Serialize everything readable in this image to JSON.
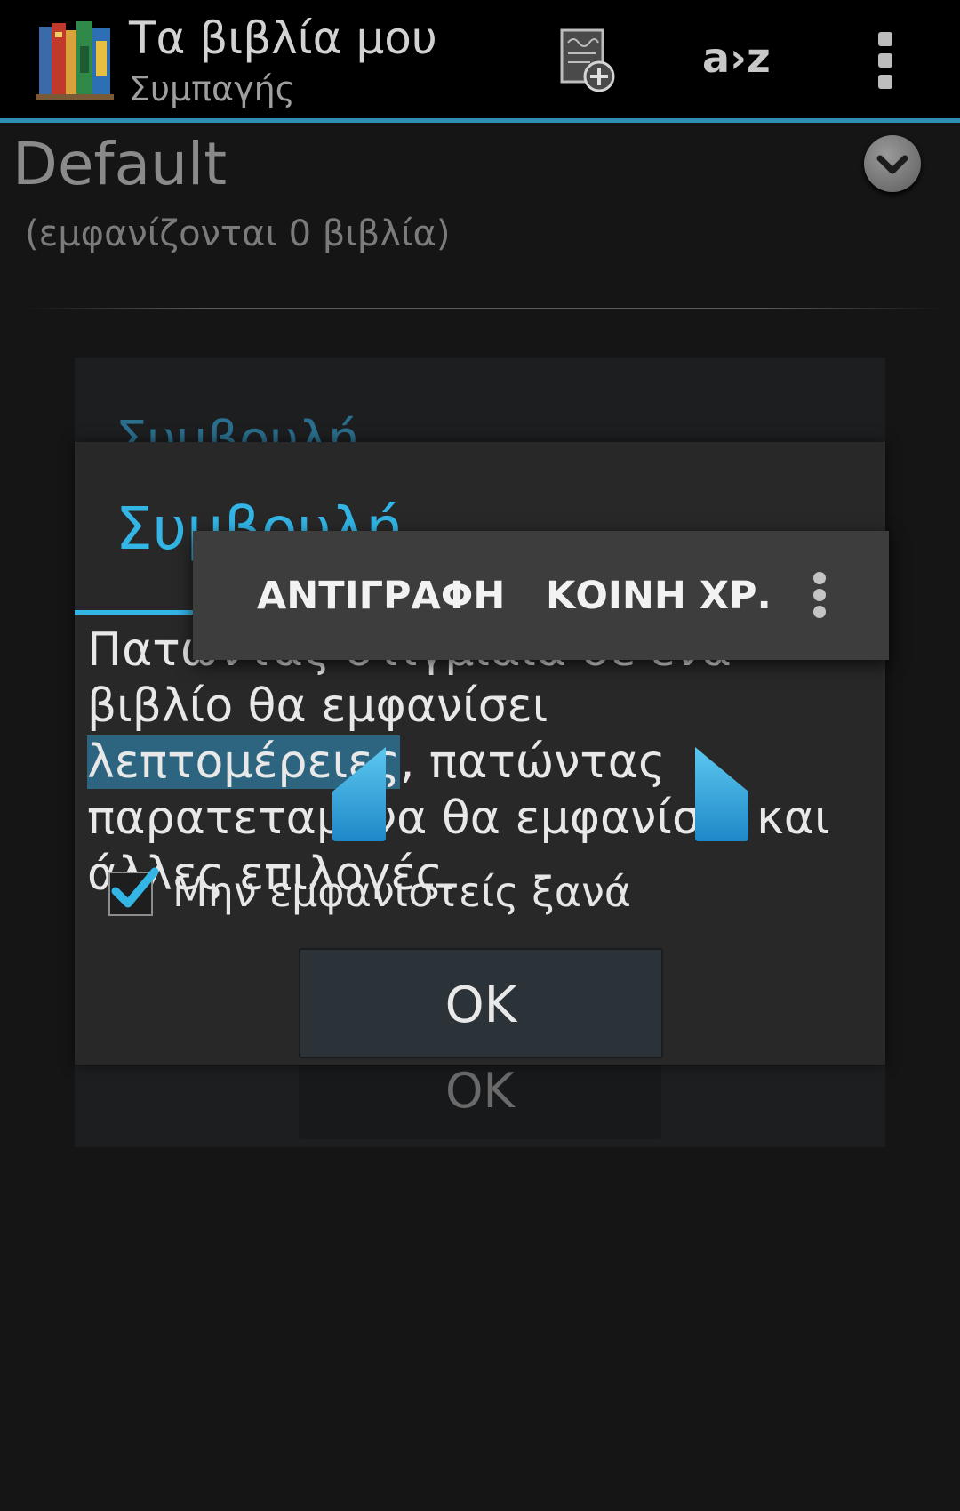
{
  "actionbar": {
    "title": "Τα βιβλία μου",
    "subtitle": "Συμπαγής",
    "sort_label": "a›z"
  },
  "shelf": {
    "name": "Default",
    "count_text": "(εμφανίζονται 0 βιβλία)"
  },
  "dialog": {
    "title": "Συμβουλή",
    "message_before": "Πατώντας στιγμιαία σε ένα βιβλίο θα εμφανίσει ",
    "message_selected": "λεπτομέρειες",
    "message_after": ", πατώντας παρατεταμένα θα εμφανίσει και άλλες επιλογές.",
    "checkbox_label": "Μην εμφανιστείς ξανά",
    "checkbox_checked": true,
    "ok_label": "OK"
  },
  "context_menu": {
    "copy_label": "ΑΝΤΙΓΡΑΦΗ",
    "share_label": "ΚΟΙΝΗ ΧΡ."
  },
  "colors": {
    "accent": "#33b5e5",
    "selection": "#2d6581",
    "background": "#151515"
  },
  "icons": {
    "app": "books-icon",
    "add_book": "add-book-icon",
    "overflow": "overflow-menu-icon",
    "shelf_toggle": "chevron-down-icon",
    "checkbox": "checkmark-icon",
    "context_more": "overflow-menu-icon"
  }
}
